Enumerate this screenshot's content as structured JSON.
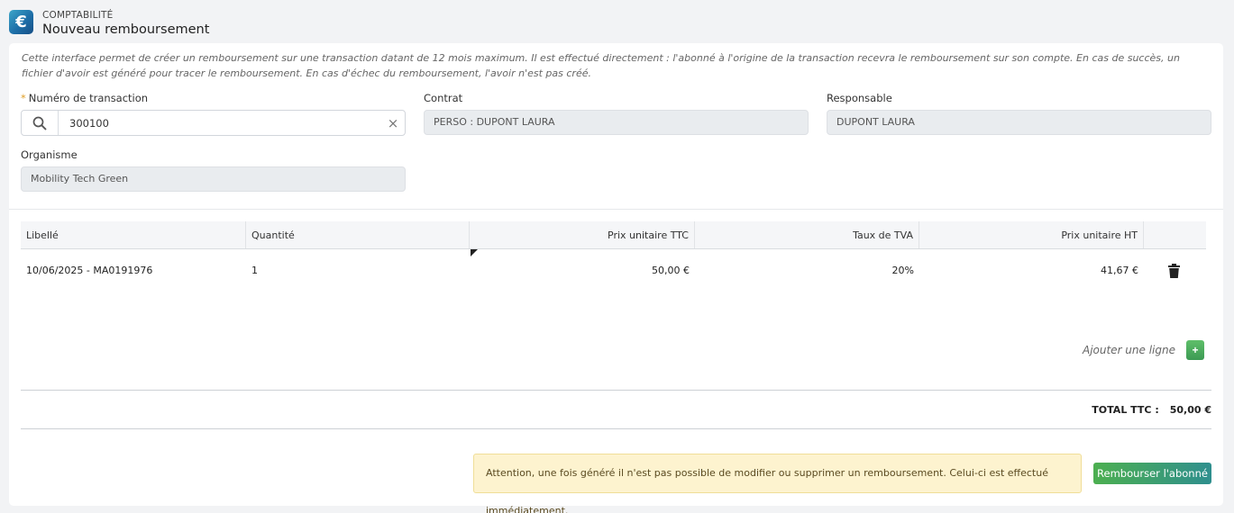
{
  "header": {
    "app_icon": "euro-icon",
    "app_icon_glyph": "€",
    "section": "COMPTABILITÉ",
    "title": "Nouveau remboursement"
  },
  "intro": "Cette interface permet de créer un remboursement sur une transaction datant de 12 mois maximum. Il est effectué directement : l'abonné à l'origine de la transaction recevra le remboursement sur son compte. En cas de succès, un fichier d'avoir est généré pour tracer le remboursement. En cas d'échec du remboursement, l'avoir n'est pas créé.",
  "form": {
    "transaction": {
      "label": "Numéro de transaction",
      "required_mark": "*",
      "value": "300100",
      "clear_glyph": "×"
    },
    "contrat": {
      "label": "Contrat",
      "value": "PERSO : DUPONT LAURA"
    },
    "responsable": {
      "label": "Responsable",
      "value": "DUPONT LAURA"
    },
    "organisme": {
      "label": "Organisme",
      "value": "Mobility Tech Green"
    }
  },
  "table": {
    "headers": {
      "libelle": "Libellé",
      "quantite": "Quantité",
      "prix_ttc": "Prix unitaire TTC",
      "tva": "Taux de TVA",
      "prix_ht": "Prix unitaire HT"
    },
    "rows": [
      {
        "libelle": "10/06/2025 - MA0191976",
        "quantite": "1",
        "prix_ttc": "50,00 €",
        "tva": "20%",
        "prix_ht": "41,67 €"
      }
    ]
  },
  "add_line": {
    "label": "Ajouter une ligne",
    "button": "+"
  },
  "total": {
    "label": "TOTAL TTC :",
    "value": "50,00 €"
  },
  "warning": "Attention, une fois généré il n'est pas possible de modifier ou supprimer un remboursement. Celui-ci est effectué immédiatement.",
  "submit_label": "Rembourser l'abonné",
  "colors": {
    "accent": "#4caf50",
    "accent_end": "#2f8f8e",
    "warning_bg": "#fdf3cf"
  }
}
